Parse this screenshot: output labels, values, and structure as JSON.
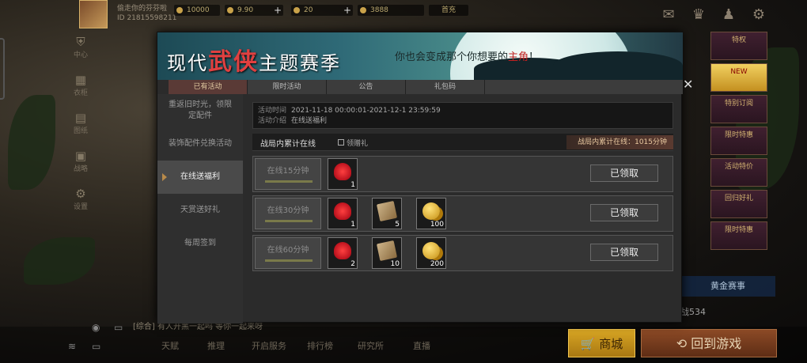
{
  "top_bar": {
    "player_name": "偷走你的芬芬啦",
    "player_id": "ID 21815598211",
    "resource_1": "10000",
    "resource_2": "9.90",
    "resource_3": "20",
    "resource_4": "3888",
    "resource_5": "首充",
    "plus": "+"
  },
  "left_nav": [
    {
      "label": "中心",
      "icon": "shield-icon"
    },
    {
      "label": "衣柜",
      "icon": "wardrobe-icon"
    },
    {
      "label": "图纸",
      "icon": "blueprint-icon"
    },
    {
      "label": "战略",
      "icon": "strategy-icon"
    },
    {
      "label": "设置",
      "icon": "gear-icon"
    }
  ],
  "right_tiles": [
    "特权",
    "NEW",
    "特别订阅",
    "限时特惠",
    "活动特价",
    "回归好礼",
    "限时特惠"
  ],
  "banner": {
    "title_pre": "现代",
    "title_wuxia": "武侠",
    "title_post": "主题赛季",
    "slogan_pre": "你也会变成那个你想要的",
    "slogan_hl": "主角",
    "slogan_post": "！"
  },
  "tabs": [
    "已有活动",
    "限时活动",
    "公告",
    "礼包码"
  ],
  "sidebar": [
    "重返旧时光，领限定配件",
    "装饰配件兑换活动",
    "在线送福利",
    "天赏送好礼",
    "每周签到"
  ],
  "info": {
    "time_label": "活动时间",
    "time_value": "2021-11-18 00:00:01-2021-12-1 23:59:59",
    "intro_label": "活动介绍",
    "intro_value": "在线送福利"
  },
  "online": {
    "title": "战局内累计在线",
    "gift_link": "领赠礼",
    "accumulated": "战局内累计在线：1015分钟"
  },
  "rewards": [
    {
      "tier": "在线15分钟",
      "items": [
        {
          "name": "rose",
          "qty": "1"
        }
      ],
      "status": "已领取"
    },
    {
      "tier": "在线30分钟",
      "items": [
        {
          "name": "rose",
          "qty": "1"
        },
        {
          "name": "ticket",
          "qty": "5"
        },
        {
          "name": "coins",
          "qty": "100"
        }
      ],
      "status": "已领取"
    },
    {
      "tier": "在线60分钟",
      "items": [
        {
          "name": "rose",
          "qty": "2"
        },
        {
          "name": "ticket",
          "qty": "10"
        },
        {
          "name": "coins",
          "qty": "200"
        }
      ],
      "status": "已领取"
    }
  ],
  "bottom": {
    "chat": "[综合] 有人开黑一起吗 等你一起来呀",
    "items": [
      "天赋",
      "推理",
      "开启服务",
      "排行榜",
      "研究所",
      "直播"
    ],
    "gold_match": "黄金赛事",
    "rank_label": "战534",
    "shop": "商城",
    "play": "回到游戏"
  },
  "colors": {
    "accent": "#d8a624",
    "play_btn": "#8c4a26",
    "active_tab": "#5a3a36"
  }
}
